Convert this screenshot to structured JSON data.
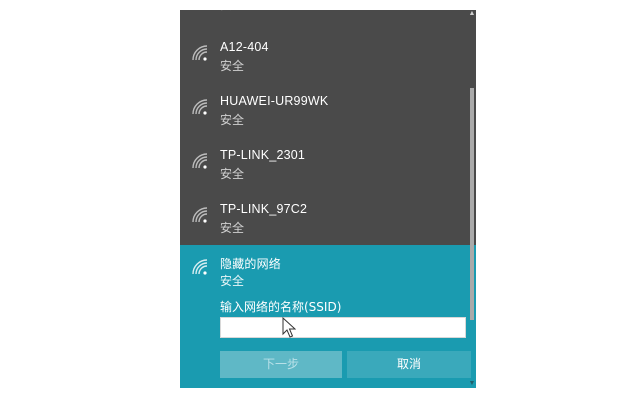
{
  "networks": [
    {
      "name": "",
      "status": "安全"
    },
    {
      "name": "A12-404",
      "status": "安全"
    },
    {
      "name": "HUAWEI-UR99WK",
      "status": "安全"
    },
    {
      "name": "TP-LINK_2301",
      "status": "安全"
    },
    {
      "name": "TP-LINK_97C2",
      "status": "安全"
    }
  ],
  "hidden_network": {
    "name": "隐藏的网络",
    "status": "安全",
    "ssid_label": "输入网络的名称(SSID)",
    "ssid_value": "",
    "next_label": "下一步",
    "cancel_label": "取消"
  },
  "scrollbar": {
    "up_arrow": "▲",
    "down_arrow": "▼"
  },
  "colors": {
    "panel_bg": "#4a4a4a",
    "selected_bg": "#1a9bb0",
    "button_next_bg": "#5fb8c6",
    "button_cancel_bg": "#3aa9bb"
  }
}
